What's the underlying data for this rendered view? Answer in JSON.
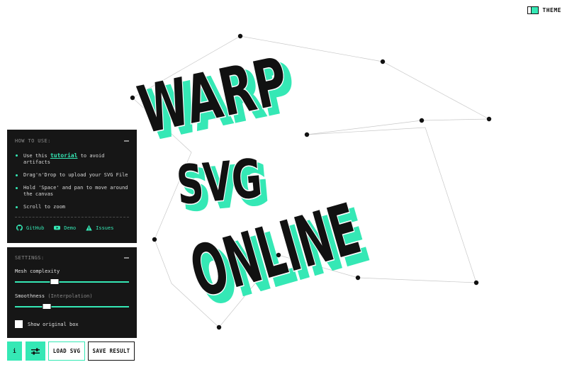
{
  "header": {
    "theme_label": "THEME",
    "theme_icon": "split-square-icon"
  },
  "artwork": {
    "lines": [
      "WARP",
      "SVG",
      "ONLINE"
    ],
    "fill_color": "#111111",
    "shadow_color": "#35e8b5"
  },
  "howto": {
    "title": "HOW TO USE:",
    "items": [
      {
        "prefix": "Use this ",
        "link": "tutorial",
        "suffix": " to avoid artifacts"
      },
      {
        "text": "Drag'n'Drop to upload your SVG File"
      },
      {
        "text": "Hold 'Space' and pan to move around the canvas"
      },
      {
        "text": "Scroll to zoom"
      }
    ],
    "links": [
      {
        "label": "GitHub",
        "icon": "github-icon"
      },
      {
        "label": "Demo",
        "icon": "youtube-icon"
      },
      {
        "label": "Issues",
        "icon": "warning-icon"
      }
    ]
  },
  "settings": {
    "title": "SETTINGS:",
    "mesh_label": "Mesh complexity",
    "mesh_value": 0.35,
    "smooth_label": "Smoothness",
    "smooth_hint": "(Interpolation)",
    "smooth_value": 0.28,
    "checkbox_label": "Show original box",
    "checkbox_checked": false
  },
  "toolbar": {
    "info_label": "i",
    "settings_icon": "sliders-icon",
    "load_label": "LOAD SVG",
    "save_label": "SAVE RESULT"
  },
  "colors": {
    "accent": "#35e8b5",
    "panel": "#161616",
    "ink": "#111111"
  }
}
